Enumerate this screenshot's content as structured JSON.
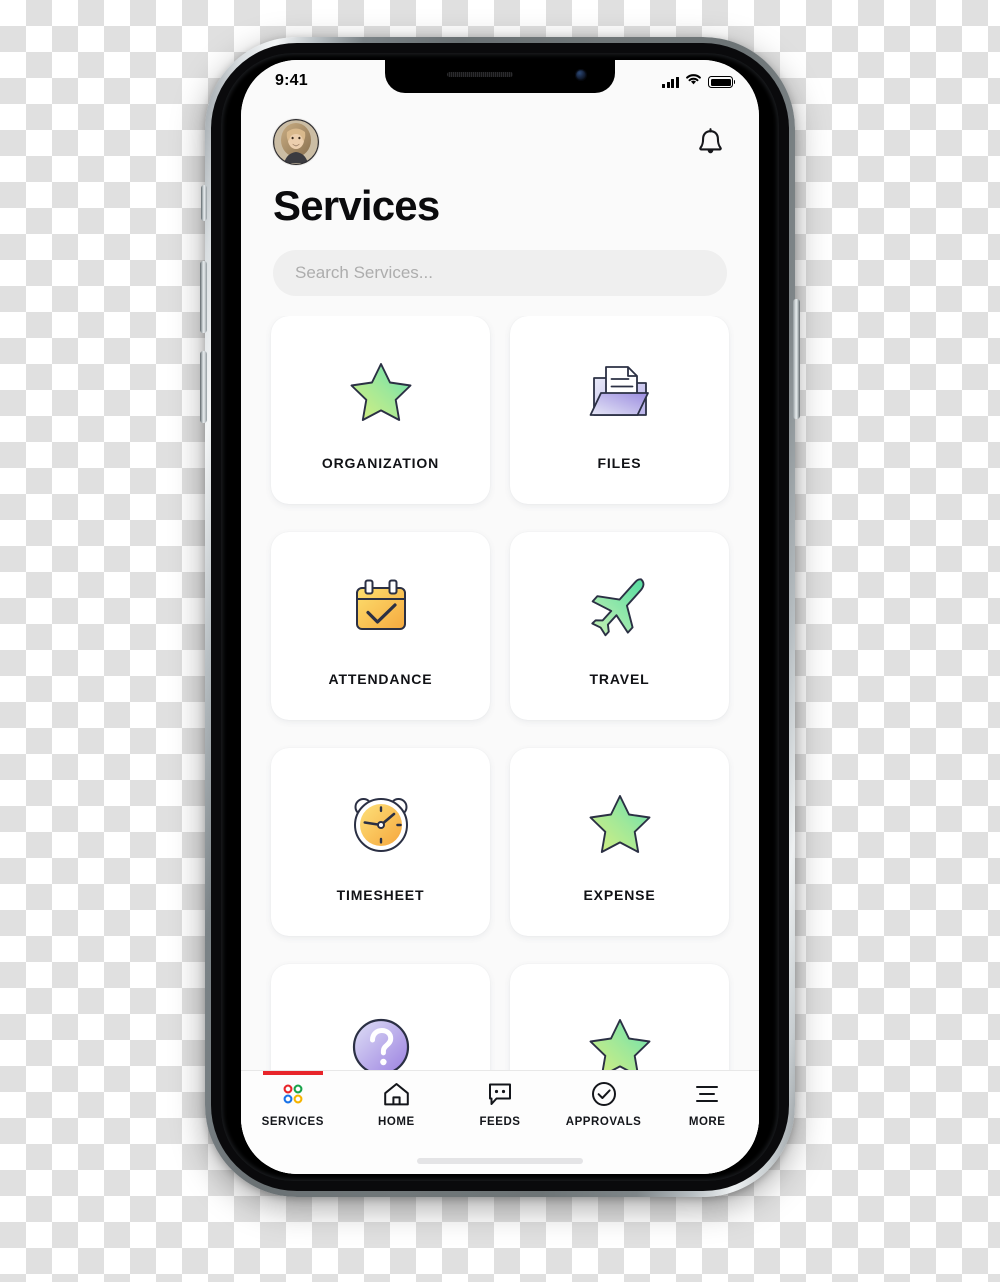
{
  "status_bar": {
    "time": "9:41",
    "signal_icon": "cellular-signal-icon",
    "wifi_icon": "wifi-icon",
    "battery_icon": "battery-full-icon"
  },
  "header": {
    "avatar_name": "user-avatar",
    "notification_icon": "bell-icon",
    "title": "Services"
  },
  "search": {
    "placeholder": "Search Services...",
    "value": ""
  },
  "tiles": [
    {
      "label": "ORGANIZATION",
      "icon": "star-icon",
      "color": "#8ce39a"
    },
    {
      "label": "FILES",
      "icon": "folder-files-icon",
      "color": "#9b8de0"
    },
    {
      "label": "ATTENDANCE",
      "icon": "calendar-check-icon",
      "color": "#f8c34a"
    },
    {
      "label": "TRAVEL",
      "icon": "airplane-icon",
      "color": "#7fe0a4"
    },
    {
      "label": "TIMESHEET",
      "icon": "alarm-clock-icon",
      "color": "#f9c council"
    },
    {
      "label": "EXPENSE",
      "icon": "star-icon",
      "color": "#8ce39a"
    },
    {
      "label": "",
      "icon": "question-mark-circle-icon",
      "color": "#a78ee0"
    },
    {
      "label": "",
      "icon": "star-icon",
      "color": "#8ce39a"
    }
  ],
  "bottom_nav": {
    "active_index": 0,
    "active_indicator_color": "#e8252a",
    "items": [
      {
        "label": "SERVICES",
        "icon": "four-dots-grid-icon"
      },
      {
        "label": "HOME",
        "icon": "house-icon"
      },
      {
        "label": "FEEDS",
        "icon": "chat-bubble-icon"
      },
      {
        "label": "APPROVALS",
        "icon": "check-circle-icon"
      },
      {
        "label": "MORE",
        "icon": "hamburger-menu-icon"
      }
    ]
  },
  "colors": {
    "accent_red": "#e8252a",
    "screen_bg": "#fafafa",
    "tile_bg": "#ffffff",
    "search_bg": "#efefef",
    "icon_outline": "#2b3044"
  }
}
